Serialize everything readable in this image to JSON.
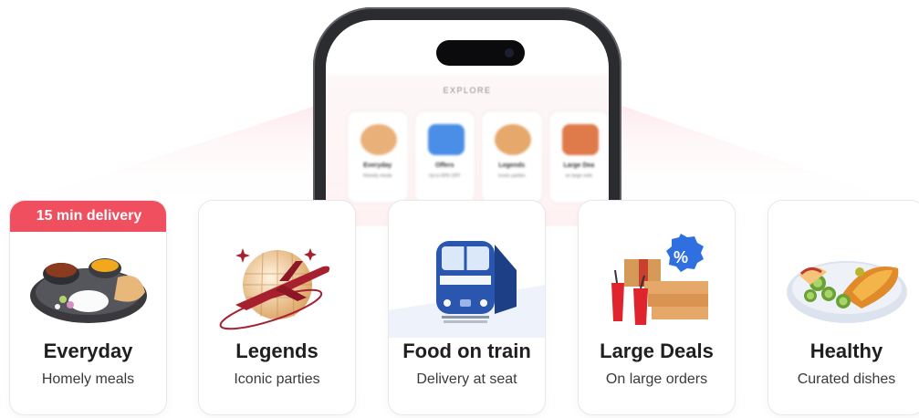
{
  "phone": {
    "explore_label": "EXPLORE",
    "mini_cards": [
      {
        "title": "Everyday",
        "subtitle": "Homely meals"
      },
      {
        "title": "Offers",
        "subtitle": "Up to 60% OFF"
      },
      {
        "title": "Legends",
        "subtitle": "Iconic parties"
      },
      {
        "title": "Large Dea",
        "subtitle": "on large orde"
      }
    ]
  },
  "cards": [
    {
      "title": "Everyday",
      "subtitle": "Homely meals",
      "badge": "15 min delivery",
      "icon": "thali-icon"
    },
    {
      "title": "Legends",
      "subtitle": "Iconic parties",
      "icon": "disco-plane-icon"
    },
    {
      "title": "Food on train",
      "subtitle": "Delivery at seat",
      "icon": "train-icon"
    },
    {
      "title": "Large Deals",
      "subtitle": "On large orders",
      "icon": "deal-boxes-icon"
    },
    {
      "title": "Healthy",
      "subtitle": "Curated dishes",
      "icon": "fruit-bowl-icon"
    }
  ],
  "colors": {
    "badge": "#ef4f5f",
    "beam": "#fdecee",
    "phone_frame": "#2b2c30"
  }
}
